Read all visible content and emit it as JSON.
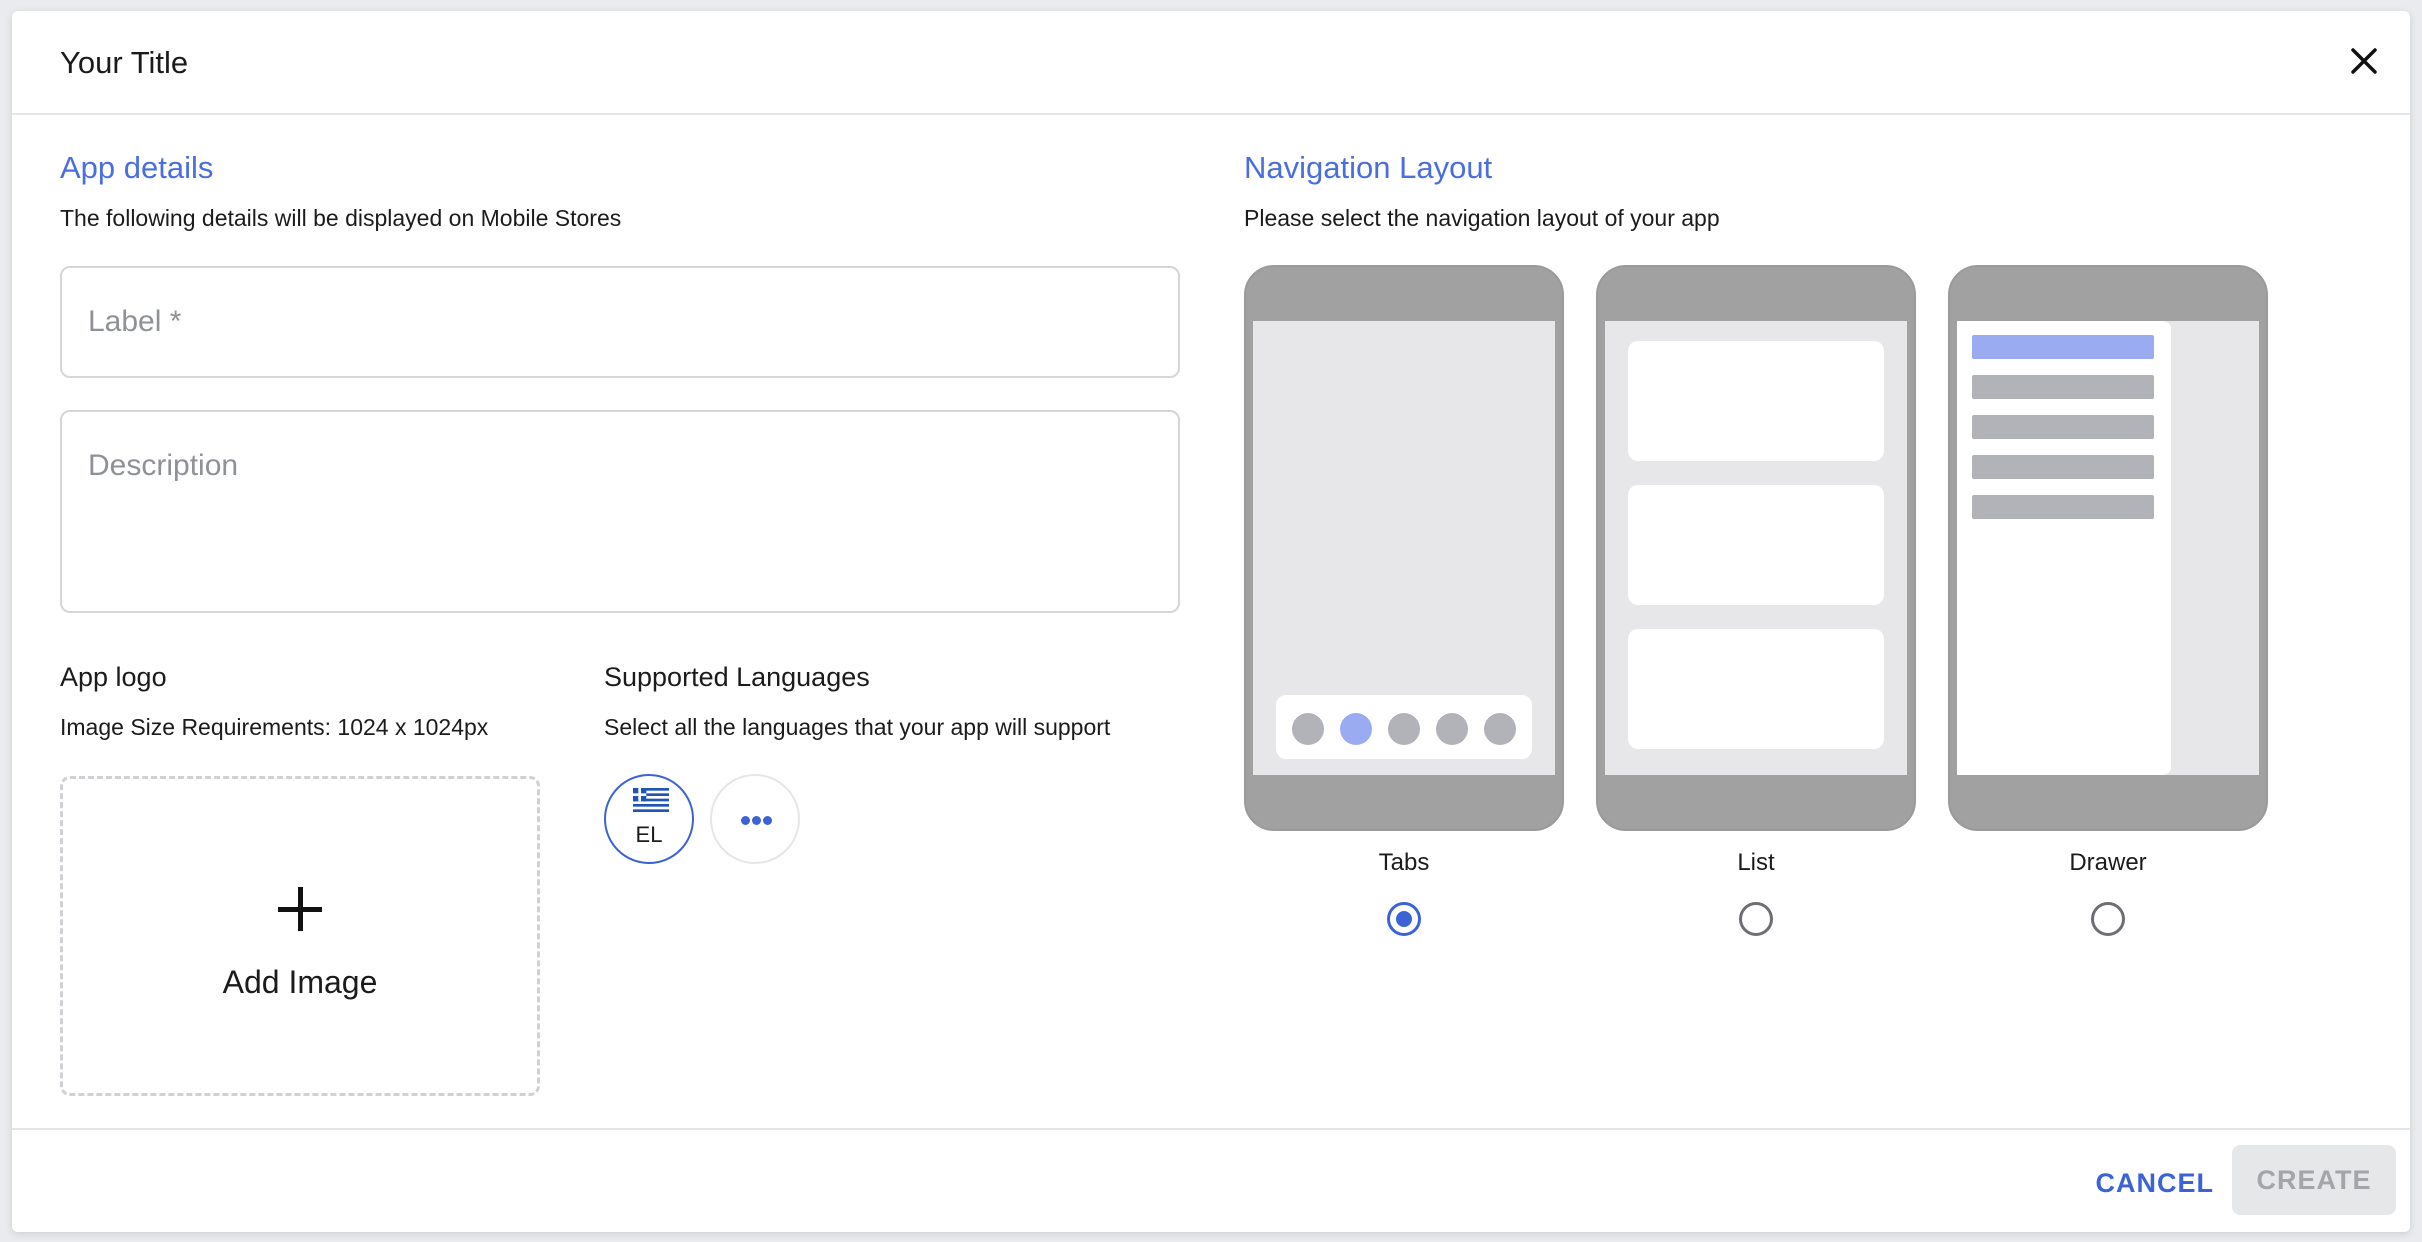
{
  "dialog": {
    "title": "Your Title",
    "close_icon": "close-icon"
  },
  "app_details": {
    "heading": "App details",
    "description": "The following details will be displayed on Mobile Stores",
    "label_placeholder": "Label *",
    "label_value": "",
    "description_placeholder": "Description",
    "description_value": ""
  },
  "app_logo": {
    "heading": "App logo",
    "requirements": "Image Size Requirements: 1024 x 1024px",
    "add_image_label": "Add Image",
    "add_icon": "plus-icon"
  },
  "languages": {
    "heading": "Supported Languages",
    "description": "Select all the languages that your app will support",
    "items": [
      {
        "code": "EL",
        "icon": "greece-flag-icon",
        "selected": true
      }
    ],
    "more_icon": "more-horizontal-icon"
  },
  "navigation": {
    "heading": "Navigation Layout",
    "description": "Please select the navigation layout of your app",
    "options": [
      {
        "label": "Tabs",
        "selected": true
      },
      {
        "label": "List",
        "selected": false
      },
      {
        "label": "Drawer",
        "selected": false
      }
    ]
  },
  "footer": {
    "cancel_label": "CANCEL",
    "create_label": "CREATE",
    "create_disabled": true
  },
  "colors": {
    "accent": "#4a6ee0",
    "primary": "#3c63d6",
    "phone_frame": "#a1a1a1",
    "highlight": "#9aabf2",
    "placeholder_bar": "#b1b3b9",
    "disabled_bg": "#e6e7e9"
  }
}
